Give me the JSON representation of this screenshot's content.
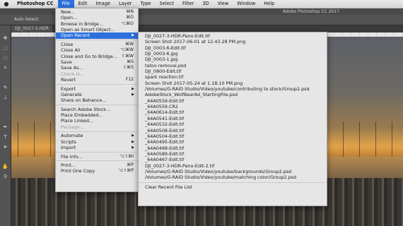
{
  "menubar": {
    "apple": "",
    "items": [
      "Photoshop CC",
      "File",
      "Edit",
      "Image",
      "Layer",
      "Type",
      "Select",
      "Filter",
      "3D",
      "View",
      "Window",
      "Help"
    ]
  },
  "window": {
    "title": "Adobe Photoshop CC 2017"
  },
  "options": {
    "auto_select": "Auto-Select:"
  },
  "document": {
    "tab": "DJI_0027-3-HDR"
  },
  "file_menu": {
    "items": [
      {
        "label": "New...",
        "shortcut": "⌘N"
      },
      {
        "label": "Open...",
        "shortcut": "⌘O"
      },
      {
        "label": "Browse in Bridge...",
        "shortcut": "⌥⌘O"
      },
      {
        "label": "Open as Smart Object...",
        "shortcut": ""
      },
      {
        "label": "Open Recent",
        "shortcut": "",
        "submenu": true,
        "highlight": true
      },
      {
        "sep": true
      },
      {
        "label": "Close",
        "shortcut": "⌘W"
      },
      {
        "label": "Close All",
        "shortcut": "⌥⌘W"
      },
      {
        "label": "Close and Go to Bridge...",
        "shortcut": "⇧⌘W"
      },
      {
        "label": "Save",
        "shortcut": "⌘S"
      },
      {
        "label": "Save As...",
        "shortcut": "⇧⌘S"
      },
      {
        "label": "Check In...",
        "shortcut": "",
        "disabled": true
      },
      {
        "label": "Revert",
        "shortcut": "F12"
      },
      {
        "sep": true
      },
      {
        "label": "Export",
        "shortcut": "",
        "submenu": true
      },
      {
        "label": "Generate",
        "shortcut": "",
        "submenu": true
      },
      {
        "label": "Share on Behance...",
        "shortcut": ""
      },
      {
        "sep": true
      },
      {
        "label": "Search Adobe Stock...",
        "shortcut": ""
      },
      {
        "label": "Place Embedded...",
        "shortcut": ""
      },
      {
        "label": "Place Linked...",
        "shortcut": ""
      },
      {
        "label": "Package...",
        "shortcut": "",
        "disabled": true
      },
      {
        "sep": true
      },
      {
        "label": "Automate",
        "shortcut": "",
        "submenu": true
      },
      {
        "label": "Scripts",
        "shortcut": "",
        "submenu": true
      },
      {
        "label": "Import",
        "shortcut": "",
        "submenu": true
      },
      {
        "sep": true
      },
      {
        "label": "File Info...",
        "shortcut": "⌥⇧⌘I"
      },
      {
        "sep": true
      },
      {
        "label": "Print...",
        "shortcut": "⌘P"
      },
      {
        "label": "Print One Copy",
        "shortcut": "⌥⇧⌘P"
      }
    ]
  },
  "recent_files": [
    "DJI_0027-3-HDR-Pano-Edit.tif",
    "Screen Shot 2017-06-01 at 12.43.28 PM.png",
    "DJI_0003-6-Edit.tif",
    "DJI_0003-6.jpg",
    "DJI_0003-1.jpg",
    "tatoo removal.psd",
    "DJI_0800-Edit.tif",
    "spark reaction.tif",
    "Screen Shot 2017-05-24 at 1.18.10 PM.png",
    "/Volumes/G-RAID Studio/Video/youtube/contributing to stock/Group2.psd",
    "AdobeStock_WolfBearAd_StartingFile.psd",
    "_64A0559-Edit.tif",
    "_64A0559.CR2",
    "_64A0614-Edit.tif",
    "_64A0541-Edit.tif",
    "_64A0532-Edit.tif",
    "_64A0508-Edit.tif",
    "_64A0504-Edit.tif",
    "_64A0495-Edit.tif",
    "_64A0468-Edit.tif",
    "_64A0589-Edit.tif",
    "_64A0467-Edit.tif",
    "DJI_0027-3-HDR-Pano-Edit-2.tif",
    "/Volumes/G-RAID Studio/Video/youtube/backgrounds/Group2.psd",
    "/Volumes/G-RAID Studio/Video/youtube/matching color/Group2.psd"
  ],
  "clear_recent": "Clear Recent File List",
  "colors": {
    "highlight": "#2c70de",
    "menu_bg": "#e4e4e4",
    "ps_panel": "#535353"
  },
  "icons": [
    "apple-icon",
    "move-tool-icon",
    "marquee-tool-icon",
    "lasso-tool-icon",
    "crop-tool-icon",
    "brush-tool-icon",
    "text-tool-icon",
    "hand-tool-icon",
    "zoom-tool-icon"
  ]
}
